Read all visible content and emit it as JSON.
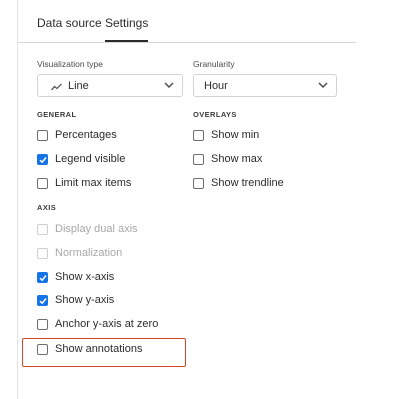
{
  "tabs": {
    "data_source": "Data source",
    "settings": "Settings"
  },
  "visualization_type": {
    "label": "Visualization type",
    "value": "Line",
    "icon": "line-chart-icon"
  },
  "granularity": {
    "label": "Granularity",
    "value": "Hour"
  },
  "general": {
    "heading": "GENERAL",
    "items": [
      {
        "label": "Percentages",
        "checked": false
      },
      {
        "label": "Legend visible",
        "checked": true
      },
      {
        "label": "Limit max items",
        "checked": false
      }
    ]
  },
  "overlays": {
    "heading": "OVERLAYS",
    "items": [
      {
        "label": "Show min",
        "checked": false
      },
      {
        "label": "Show max",
        "checked": false
      },
      {
        "label": "Show trendline",
        "checked": false
      }
    ]
  },
  "axis": {
    "heading": "AXIS",
    "items": [
      {
        "label": "Display dual axis",
        "checked": false,
        "disabled": true
      },
      {
        "label": "Normalization",
        "checked": false,
        "disabled": true
      },
      {
        "label": "Show x-axis",
        "checked": true
      },
      {
        "label": "Show y-axis",
        "checked": true
      },
      {
        "label": "Anchor y-axis at zero",
        "checked": false
      },
      {
        "label": "Show annotations",
        "checked": false
      }
    ]
  },
  "colors": {
    "accent": "#1473e6",
    "highlight": "#d9442b"
  }
}
